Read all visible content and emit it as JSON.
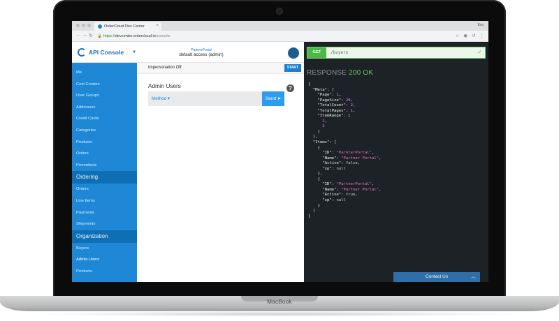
{
  "browser": {
    "tab_title": "OrderCloud Dev Center",
    "tab_close": "×",
    "user": "Eric",
    "url_protocol": "https://",
    "url_host": "devcenter.ordercloud.io",
    "url_path": "/console",
    "secure_icon": "lock-icon"
  },
  "header": {
    "logo_text": "API Console",
    "context_line1": "PartnerPortal",
    "context_line2": "default access (admin)"
  },
  "sidebar": {
    "items_top": [
      "Me",
      "Cost Centers",
      "User Groups",
      "Addresses",
      "Credit Cards",
      "Categories",
      "Products",
      "Orders",
      "Promotions"
    ],
    "section_ordering": "Ordering",
    "items_ordering": [
      "Orders",
      "Line Items",
      "Payments",
      "Shipments"
    ],
    "section_org": "Organization",
    "items_org": [
      "Buyers",
      "Admin Users",
      "Products"
    ]
  },
  "panel": {
    "impersonation": "Impersonation Off",
    "start_label": "START",
    "title": "Admin Users",
    "method_label": "Method ▾",
    "send_label": "Send"
  },
  "console": {
    "method": "GET",
    "endpoint": "/buyers",
    "response_label": "RESPONSE",
    "response_code": "200 OK"
  },
  "contact_label": "Contact Us",
  "device_brand": "MacBook",
  "colors": {
    "primary": "#1e88d6",
    "section": "#0f6fb5",
    "console_bg": "#1d2226",
    "success": "#4cb848"
  }
}
